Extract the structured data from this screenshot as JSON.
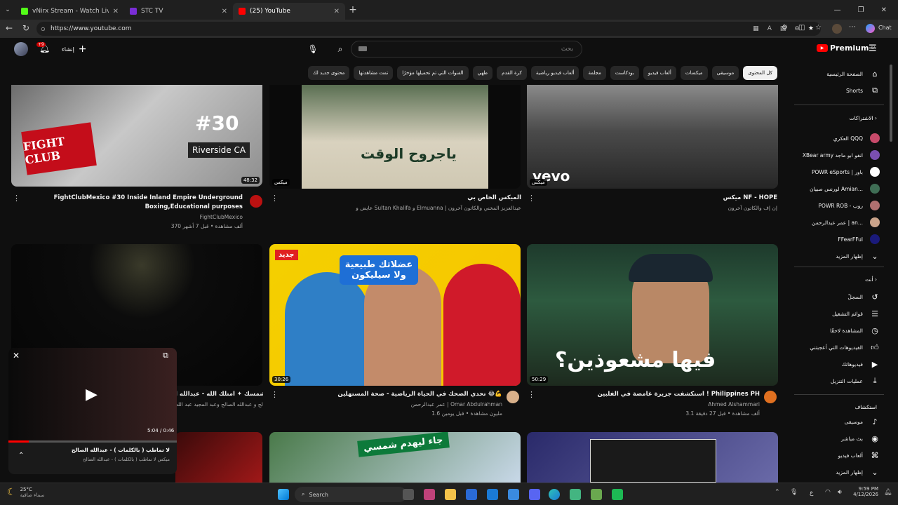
{
  "browser": {
    "tabs": [
      {
        "label": "vNirx Stream - Watch Live on Kick",
        "fav": "#53fc18"
      },
      {
        "label": "STC TV",
        "fav": "#7a2dd6"
      },
      {
        "label": "(25) YouTube",
        "fav": "#ff0000"
      }
    ],
    "url": "https://www.youtube.com",
    "chat_label": "Chat"
  },
  "masthead": {
    "logo": "Premium",
    "logo_sup": "SA",
    "search_placeholder": "بحث",
    "create_label": "إنشاء",
    "notif_count": "+9"
  },
  "chips": [
    "كل المحتوى",
    "موسيقى",
    "ميكسات",
    "ألعاب فيديو",
    "بودكاست",
    "مجلمة",
    "ألعاب فيديو رياضية",
    "كرة القدم",
    "طهي",
    "الفنوات التي تم تحميلها مؤخرًا",
    "تمت مشاهدتها",
    "محتوى جديد لك"
  ],
  "sidebar": {
    "main": [
      {
        "label": "الصفحة الرئيسية",
        "icon": "home-icon"
      },
      {
        "label": "Shorts",
        "icon": "shorts-icon"
      }
    ],
    "subs_header": "الاشتراكات",
    "subs": [
      {
        "label": "العكري QQQ",
        "color": "#c74a6a"
      },
      {
        "label": "XBear army انفو ابو ماجد",
        "color": "#7a4fb0"
      },
      {
        "label": "POWR eSports | باور",
        "color": "#ffffff"
      },
      {
        "label": "لورنس صبيان Amian...",
        "color": "#3f6e55"
      },
      {
        "label": "POWR ROB - روب",
        "color": "#b07070"
      },
      {
        "label": "عمر عبدالرحمن | an...",
        "color": "#caa38a"
      },
      {
        "label": "FFearFFul",
        "color": "#1a1a7a"
      },
      {
        "label": "إظهار المزيد",
        "color": ""
      }
    ],
    "you_header": "أنت",
    "you": [
      {
        "label": "السجلّ",
        "icon": "history-icon"
      },
      {
        "label": "قوائم التشغيل",
        "icon": "playlist-icon"
      },
      {
        "label": "المشاهدة لاحقًا",
        "icon": "clock-icon"
      },
      {
        "label": "الفيديوهات التي أعجبتني",
        "icon": "like-icon"
      },
      {
        "label": "فيديوهاتك",
        "icon": "video-icon"
      },
      {
        "label": "عمليات التنزيل",
        "icon": "download-icon"
      }
    ],
    "explore_header": "استكشاف",
    "explore": [
      {
        "label": "موسيقى",
        "icon": "music-icon"
      },
      {
        "label": "بث مباشر",
        "icon": "live-icon"
      },
      {
        "label": "ألعاب فيديو",
        "icon": "gaming-icon"
      },
      {
        "label": "إظهار المزيد",
        "icon": "chevron-down-icon"
      }
    ]
  },
  "videos": [
    {
      "thumb_text": "#30",
      "thumb_sub": "Riverside CA",
      "badge": "FIGHT CLUB",
      "duration": "48:32",
      "title": "FightClubMexico #30 Inside Inland Empire Underground Boxing,Educational purposes",
      "channel": "FightClubMexico",
      "stats": "370 ألف مشاهدة • قبل 7 أشهر"
    },
    {
      "thumb_text": "ياجروح الوقت",
      "badge": "ميكس",
      "duration": "",
      "title": "الميكس الخاص بي",
      "channel": "عايض و Sultan Khalifa و Elmuanna | عبدالعزيز المخني والكاتون آخرون",
      "stats": ""
    },
    {
      "thumb_text": "vevo",
      "badge": "ميكس",
      "duration": "",
      "title": "ميكس NF - HOPE",
      "channel": "إن إف والكاتون آخرون",
      "stats": ""
    },
    {
      "thumb_text": "",
      "duration": "",
      "title": "ميكس احب شمسك ✦ امتلك الله - عبدالله ا...",
      "channel": "عبدالله الصالح و عبدالله الصالح وعبد المجيد عبد الله",
      "stats": ""
    },
    {
      "thumb_text": "عضلاتك طبيعية ولا سيليكون",
      "badge": "جديد",
      "duration": "30:26",
      "title": "تحدي الضحك في الحياة الرياضية - صحة المستهلين 😂💪",
      "channel": "عمر عبدالرحمن | Omar Abdulrahman",
      "stats": "1.6 مليون مشاهدة • قبل يومين"
    },
    {
      "thumb_text": "فيها مشعوذين؟",
      "duration": "50:29",
      "title": "استكشفت جزيرة غامضة في الفلبين ! Philippines PH",
      "channel": "Ahmed Alshammari",
      "stats": "3.1 ألف مشاهدة • قبل 27 دقيقة"
    }
  ],
  "row3": [
    {
      "thumb_text": ""
    },
    {
      "thumb_text": "جاء ليهدم شمسي"
    },
    {
      "thumb_text": ""
    }
  ],
  "miniplayer": {
    "title": "لا تماطب ( بالكلمات ) - عبدالله الصالح",
    "subtitle": "ميكس لا تماطب ( بالكلمات ) - عبدالله الصالح",
    "time": "5:04 / 0:46",
    "progress": 0.12
  },
  "taskbar": {
    "weather_temp": "25°C",
    "weather_desc": "سماء صافية",
    "search": "Search",
    "time": "9:59 PM",
    "date": "4/12/2026",
    "lang": "ع"
  }
}
